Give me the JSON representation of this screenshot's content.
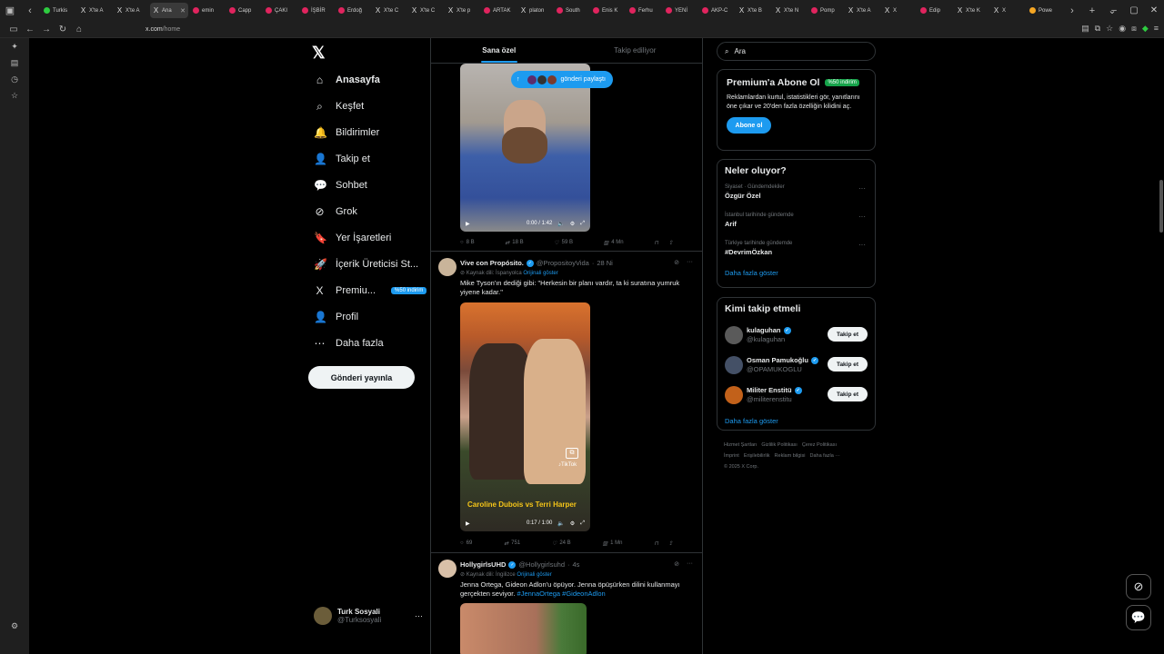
{
  "browser": {
    "tabs": [
      {
        "label": "Turkis",
        "color": "#2ecc40"
      },
      {
        "label": "X'te A",
        "color": "x"
      },
      {
        "label": "X'te A",
        "color": "x"
      },
      {
        "label": "Ana",
        "color": "x",
        "active": true
      },
      {
        "label": "emin",
        "color": "#e0245e"
      },
      {
        "label": "Capp",
        "color": "#e0245e"
      },
      {
        "label": "ÇAKI",
        "color": "#e0245e"
      },
      {
        "label": "İŞBİR",
        "color": "#e0245e"
      },
      {
        "label": "Erdoğ",
        "color": "#e0245e"
      },
      {
        "label": "X'te C",
        "color": "x"
      },
      {
        "label": "X'te C",
        "color": "x"
      },
      {
        "label": "X'te p",
        "color": "x"
      },
      {
        "label": "ARTAK",
        "color": "#e0245e"
      },
      {
        "label": "platon",
        "color": "x"
      },
      {
        "label": "South",
        "color": "#e0245e"
      },
      {
        "label": "Enis K",
        "color": "#e0245e"
      },
      {
        "label": "Ferhu",
        "color": "#e0245e"
      },
      {
        "label": "YENİ",
        "color": "#e0245e"
      },
      {
        "label": "AKP-C",
        "color": "#e0245e"
      },
      {
        "label": "X'te B",
        "color": "x"
      },
      {
        "label": "X'te N",
        "color": "x"
      },
      {
        "label": "Pomp",
        "color": "#e0245e"
      },
      {
        "label": "X'te A",
        "color": "x"
      },
      {
        "label": "X",
        "color": "x"
      },
      {
        "label": "Edip",
        "color": "#e0245e"
      },
      {
        "label": "X'te K",
        "color": "x"
      },
      {
        "label": "X",
        "color": "x"
      },
      {
        "label": "Powe",
        "color": "#f5a623"
      }
    ],
    "url_host": "x.com",
    "url_path": "/home"
  },
  "nav": {
    "items": [
      {
        "label": "Anasayfa",
        "icon": "home-icon",
        "glyph": "⌂"
      },
      {
        "label": "Keşfet",
        "icon": "search-icon",
        "glyph": "⌕"
      },
      {
        "label": "Bildirimler",
        "icon": "bell-icon",
        "glyph": "🔔"
      },
      {
        "label": "Takip et",
        "icon": "follow-icon",
        "glyph": "👤"
      },
      {
        "label": "Sohbet",
        "icon": "chat-icon",
        "glyph": "💬"
      },
      {
        "label": "Grok",
        "icon": "grok-icon",
        "glyph": "⊘"
      },
      {
        "label": "Yer İşaretleri",
        "icon": "bookmark-icon",
        "glyph": "🔖"
      },
      {
        "label": "İçerik Üreticisi St...",
        "icon": "rocket-icon",
        "glyph": "🚀"
      },
      {
        "label": "Premiu...",
        "icon": "x-premium-icon",
        "glyph": "X",
        "badge": "%50 indirim"
      },
      {
        "label": "Profil",
        "icon": "profile-icon",
        "glyph": "👤"
      },
      {
        "label": "Daha fazla",
        "icon": "more-icon",
        "glyph": "⋯"
      }
    ],
    "post_button": "Gönderi yayınla",
    "account": {
      "name": "Turk Sosyali",
      "handle": "@Turksosyali"
    }
  },
  "feed": {
    "tabs": [
      "Sana özel",
      "Takip ediliyor"
    ],
    "new_posts_label": "gönderi paylaştı",
    "tweets": [
      {
        "video_time": "0:00 / 1:42",
        "actions": {
          "replies": "8 B",
          "reposts": "18 B",
          "likes": "59 B",
          "views": "4 Mn"
        }
      },
      {
        "name": "Vive con Propósito.",
        "handle": "@PropositoyVida",
        "time": "28 Ni",
        "source": "Kaynak dili: İspanyolca",
        "original": "Orijinali göster",
        "text": "Mike Tyson'ın dediği gibi: \"Herkesin bir planı vardır, ta ki suratına yumruk yiyene kadar.\"",
        "overlay_caption": "Caroline Dubois vs Terri Harper",
        "tiktok": "TikTok",
        "video_time": "0:17 / 1:00",
        "actions": {
          "replies": "69",
          "reposts": "751",
          "likes": "24 B",
          "views": "1 Mn"
        }
      },
      {
        "name": "HollygirlsUHD",
        "handle": "@Hollygirlsuhd",
        "time": "4s",
        "source": "Kaynak dili: İngilizce",
        "original": "Orijinali göster",
        "text": "Jenna Ortega, Gideon Adlon'u öpüyor. Jenna öpüşürken dilini kullanmayı gerçekten seviyor.",
        "tags": "#JennaOrtega #GideonAdlon"
      }
    ]
  },
  "right": {
    "search_placeholder": "Ara",
    "premium": {
      "title": "Premium'a Abone Ol",
      "badge": "%50 indirim",
      "desc": "Reklamlardan kurtul, istatistikleri gör, yanıtlarını öne çıkar ve 20'den fazla özelliğin kilidini aç.",
      "button": "Abone ol"
    },
    "trends": {
      "title": "Neler oluyor?",
      "items": [
        {
          "context": "Siyaset · Gündemdekiler",
          "topic": "Özgür Özel"
        },
        {
          "context": "İstanbul tarihinde gündemde",
          "topic": "Arif"
        },
        {
          "context": "Türkiye tarihinde gündemde",
          "topic": "#DevrimÖzkan"
        }
      ],
      "show_more": "Daha fazla göster"
    },
    "who_to_follow": {
      "title": "Kimi takip etmeli",
      "users": [
        {
          "name": "kulaguhan",
          "handle": "@kulaguhan",
          "color": "#5a5a5a"
        },
        {
          "name": "Osman Pamukoğlu",
          "handle": "@OPAMUKOGLU",
          "color": "#445066"
        },
        {
          "name": "Militer Enstitü",
          "handle": "@militerenstitu",
          "color": "#c2611a"
        }
      ],
      "follow_label": "Takip et",
      "show_more": "Daha fazla göster"
    },
    "footer": [
      "Hizmet Şartları",
      "Gizlilik Politikası",
      "Çerez Politikası",
      "İmprint",
      "Erişilebilirlik",
      "Reklam bilgisi",
      "Daha fazla ···",
      "© 2025 X Corp."
    ]
  }
}
